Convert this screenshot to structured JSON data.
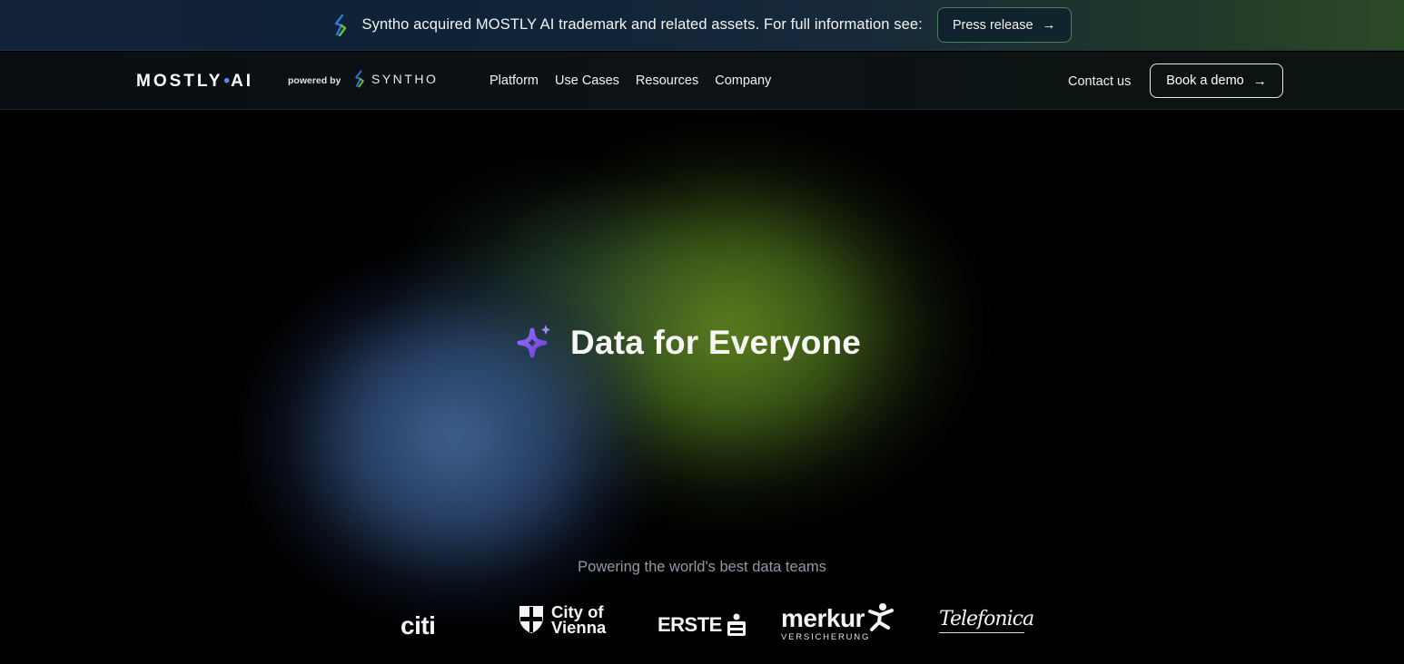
{
  "announcement": {
    "icon": "syntho-s-icon",
    "message": "Syntho acquired MOSTLY AI trademark and related assets. For full information see:",
    "button_label": "Press release",
    "button_arrow": "→"
  },
  "nav": {
    "logo_part1": "MOSTLY",
    "logo_dot": "•",
    "logo_part2": "AI",
    "powered_by": "powered by",
    "partner_logo": "SYNTHO",
    "menu": [
      "Platform",
      "Use Cases",
      "Resources",
      "Company"
    ],
    "contact_label": "Contact us",
    "demo_label": "Book a demo",
    "demo_arrow": "→"
  },
  "hero": {
    "title": "Data for Everyone",
    "icon": "sparkle-icon",
    "tagline": "Powering the world's best data teams"
  },
  "customer_logos": {
    "citi": "citi",
    "vienna_line1": "City of",
    "vienna_line2": "Vienna",
    "erste": "ERSTE",
    "merkur": "merkur",
    "merkur_sub": "VERSICHERUNG",
    "telefonica": "Telefonica"
  },
  "colors": {
    "accent_blue": "#4f8ef7",
    "accent_purple": "#8b5cf6",
    "press_border": "#4a7f61"
  }
}
